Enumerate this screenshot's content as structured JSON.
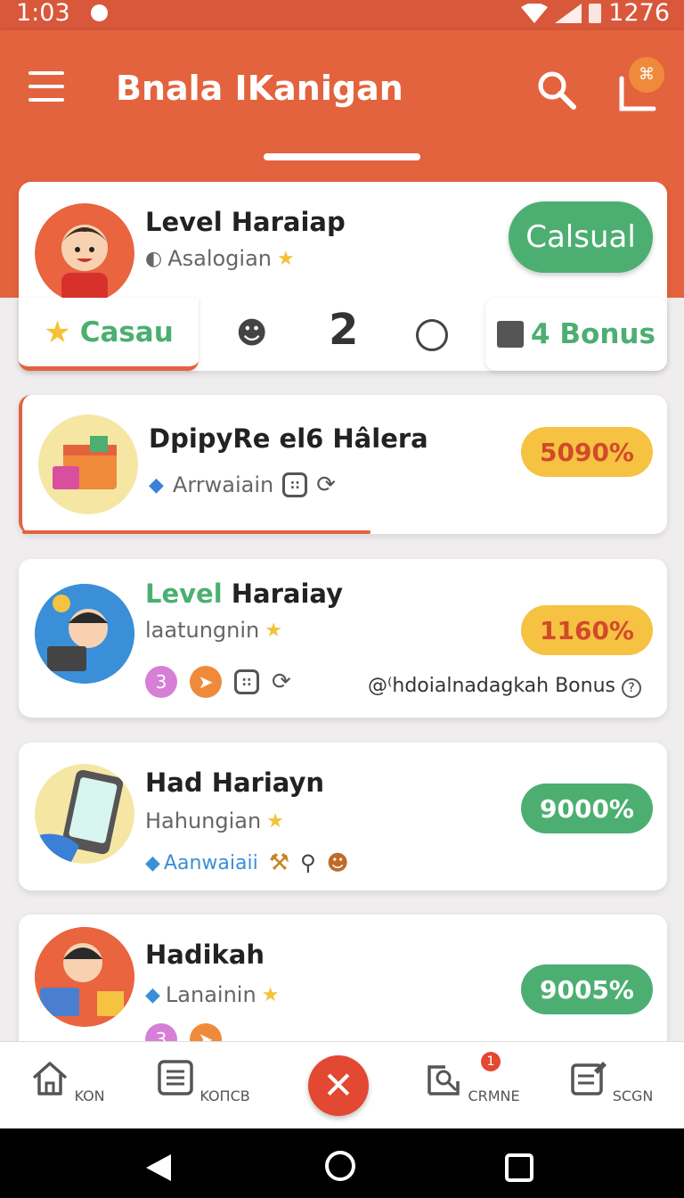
{
  "status": {
    "time": "1:03",
    "battery": "1276"
  },
  "appbar": {
    "title": "Bnala IKanigan",
    "cart_badge": "⌘"
  },
  "cards": [
    {
      "title": "Level Haraiap",
      "subtitle": "Asalogian",
      "action": "Calsual",
      "stat_left": "Casau",
      "stat_number": "2",
      "stat_right": "4 Bonus"
    },
    {
      "title": "DpipyRe el6 Hâlera",
      "subtitle": "Arrwaiain",
      "percent": "5090%",
      "progress": 0.54
    },
    {
      "title_green": "Level",
      "title_rest": "Haraiay",
      "subtitle": "laatungnin",
      "badge_number": "3",
      "bonus_text": "@⁽hdoialnadagkah Bonus",
      "percent": "1160%"
    },
    {
      "title": "Had Hariayn",
      "subtitle": "Hahungian",
      "tag": "Aanwaiaii",
      "percent": "9000%"
    },
    {
      "title": "Hadikah",
      "subtitle": "Lanainin",
      "badge_number": "3",
      "percent": "9005%"
    }
  ],
  "bottom_nav": [
    {
      "label": "KON",
      "icon": "home-icon"
    },
    {
      "label": "KOПCB",
      "icon": "list-icon"
    },
    {
      "label": "CRMNE",
      "icon": "tools-icon",
      "badge": "1"
    },
    {
      "label": "SCGN",
      "icon": "edit-icon"
    }
  ],
  "colors": {
    "primary": "#e3633e",
    "green": "#4caf71",
    "yellow": "#f5c242",
    "fab": "#e24832"
  }
}
